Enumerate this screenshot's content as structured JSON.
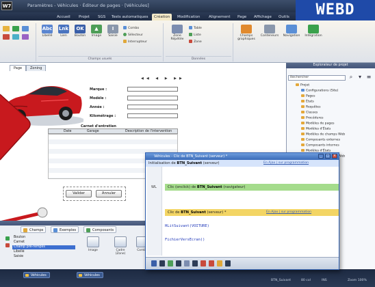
{
  "app": {
    "logo": "W7",
    "window_title": "Paramètres - Véhicules · Éditeur de pages · [Véhicules]",
    "brand": "WEBD"
  },
  "menu_tabs": [
    "Accueil",
    "Projet",
    "SGS",
    "Tests automatiques",
    "Création",
    "Modification",
    "Alignement",
    "Page",
    "Affichage",
    "Outils"
  ],
  "ribbon": {
    "buttons": [
      {
        "label": "Libellé",
        "glyph": "Abc"
      },
      {
        "label": "Lien",
        "glyph": "Lnk"
      },
      {
        "label": "Bouton",
        "glyph": "OK"
      },
      {
        "label": "Image",
        "glyph": "▲"
      },
      {
        "label": "Saisie",
        "glyph": "I"
      }
    ],
    "small": [
      "Combo",
      "Sélecteur",
      "Interrupteur"
    ],
    "small2": [
      "Table",
      "Liste",
      "Zone"
    ],
    "big": [
      {
        "label": "Zone Répétée"
      },
      {
        "label": "Champs graphiques"
      },
      {
        "label": "Conteneurs"
      },
      {
        "label": "Navigation"
      },
      {
        "label": "Intégration"
      }
    ],
    "groups": [
      "Champs usuels",
      "Données"
    ]
  },
  "page_tabs": [
    "Page",
    "Zoning"
  ],
  "form": {
    "labels": [
      "Marque :",
      "Modèle :",
      "Année :",
      "Kilométrage :"
    ],
    "section_title": "Carnet d'entretien",
    "columns": [
      "Date",
      "Garage",
      "Description de l'intervention"
    ],
    "btn_validate": "Valider",
    "btn_cancel": "Annuler"
  },
  "explorer": {
    "title": "Explorateur de projet",
    "search_placeholder": "Rechercher",
    "items": [
      {
        "label": "Projet",
        "color": "#e4a83a",
        "level": 0
      },
      {
        "label": "Configurations (Site)",
        "color": "#5a8fd6",
        "level": 1
      },
      {
        "label": "Pages",
        "color": "#e4a83a",
        "level": 1
      },
      {
        "label": "États",
        "color": "#e4a83a",
        "level": 1
      },
      {
        "label": "Requêtes",
        "color": "#e4a83a",
        "level": 1
      },
      {
        "label": "Classes",
        "color": "#e4a83a",
        "level": 1
      },
      {
        "label": "Procédures",
        "color": "#e4a83a",
        "level": 1
      },
      {
        "label": "Modèles de pages",
        "color": "#e4a83a",
        "level": 1
      },
      {
        "label": "Modèles d'États",
        "color": "#e4a83a",
        "level": 1
      },
      {
        "label": "Modèles de champs Web",
        "color": "#e4a83a",
        "level": 1
      },
      {
        "label": "Composants externes",
        "color": "#e4a83a",
        "level": 1
      },
      {
        "label": "Composants internes",
        "color": "#e4a83a",
        "level": 1
      },
      {
        "label": "Modèles d'États",
        "color": "#e4a83a",
        "level": 1
      },
      {
        "label": "Modèles de champs Web",
        "color": "#e4a83a",
        "level": 1
      }
    ]
  },
  "code_window": {
    "title": "Véhicules - Clic de BTN_Suivant (serveur) *",
    "events": [
      {
        "prefix": "Initialisation de ",
        "name": "BTN_Suivant",
        "suffix": " (serveur)",
        "link": "En Ajax | sur programmation"
      },
      {
        "prefix": "Clic (onclick) de ",
        "name": "BTN_Suivant",
        "suffix": " (navigateur)",
        "link": ""
      },
      {
        "prefix": "Clic de ",
        "name": "BTN_Suivant",
        "suffix": " (serveur) *",
        "link": "En Ajax | sur programmation"
      }
    ],
    "gutter_labels": [
      "WL",
      "WL"
    ],
    "code_lines": [
      "HLitSuivant(VOITURE)",
      "FichierVersEcran()"
    ]
  },
  "bottom_panel": {
    "tabs": [
      "Champs",
      "Exemples",
      "Composants"
    ],
    "list": [
      "Bouton",
      "Carnet",
      "Champ pré-remplis",
      "Libellé",
      "Saisie"
    ],
    "selected_index": 2,
    "controls": [
      "Image",
      "Cadre (Zone)",
      "Combo"
    ]
  },
  "status": {
    "tabs": [
      "Véhicules",
      "Véhicules"
    ],
    "right_items": [
      "BTN_Suivant",
      "80 col",
      "INS",
      "Zoom 100%"
    ]
  },
  "colors": {
    "accent": "#1f4aa8",
    "car_red": "#c8191e",
    "event_band_blue": "#d6e4fb",
    "event_band_green": "#a5dc8c",
    "event_band_yellow": "#f3d564"
  }
}
